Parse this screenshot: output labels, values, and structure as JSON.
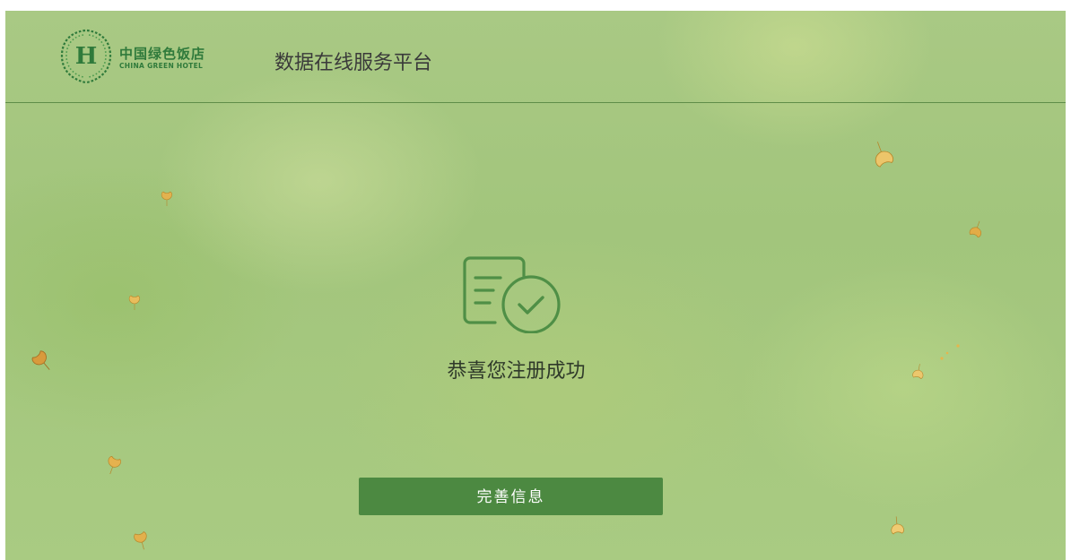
{
  "header": {
    "logo": {
      "letter": "H",
      "name_cn": "中国绿色饭店",
      "name_en": "CHINA GREEN HOTEL"
    },
    "title": "数据在线服务平台"
  },
  "main": {
    "icon": "document-check-icon",
    "message": "恭喜您注册成功",
    "button_label": "完善信息"
  },
  "colors": {
    "brand_green": "#2f7a3b",
    "button_green": "#4c8941",
    "icon_green": "#4f8f46",
    "header_rule": "#5f8d48"
  }
}
